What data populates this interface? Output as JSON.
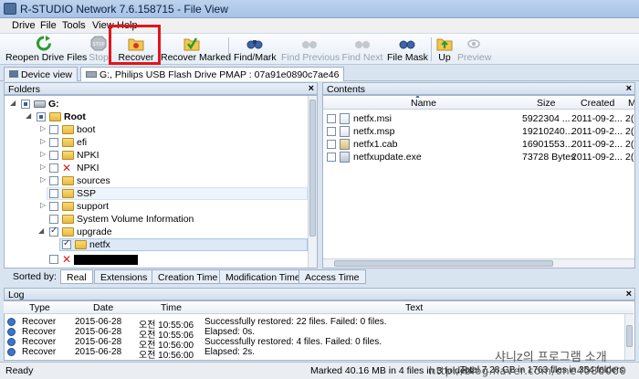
{
  "window": {
    "title": "R-STUDIO Network 7.6.158715 - File View"
  },
  "menu": [
    "Drive",
    "File",
    "Tools",
    "View",
    "Help"
  ],
  "toolbar": {
    "buttons": [
      {
        "label": "Reopen Drive Files",
        "icon": "green-refresh-icon",
        "enabled": true
      },
      {
        "label": "Stop",
        "icon": "stop-icon",
        "enabled": false
      },
      {
        "label": "Recover",
        "icon": "recover-folder-icon",
        "enabled": true
      },
      {
        "label": "Recover Marked",
        "icon": "recover-marked-icon",
        "enabled": true
      },
      {
        "label": "Find/Mark",
        "icon": "binoculars-icon",
        "enabled": true
      },
      {
        "label": "Find Previous",
        "icon": "binoculars-prev-icon",
        "enabled": false
      },
      {
        "label": "Find Next",
        "icon": "binoculars-next-icon",
        "enabled": false
      },
      {
        "label": "File Mask",
        "icon": "file-mask-icon",
        "enabled": true
      },
      {
        "label": "Up",
        "icon": "folder-up-icon",
        "enabled": true
      },
      {
        "label": "Preview",
        "icon": "eye-icon",
        "enabled": false
      }
    ],
    "highlighted": "Recover"
  },
  "tabs": [
    {
      "label": "Device view",
      "icon": "device-icon"
    },
    {
      "label": "G:, Philips USB Flash Drive PMAP : 07a91e0890c7ae46",
      "icon": "drive-icon"
    }
  ],
  "folders_pane": {
    "title": "Folders",
    "tree": [
      {
        "label": "G:",
        "bold": true,
        "expanded": true
      },
      {
        "label": "Root",
        "bold": true,
        "expanded": true
      },
      {
        "label": "boot"
      },
      {
        "label": "efi"
      },
      {
        "label": "NPKI"
      },
      {
        "label": "NPKI"
      },
      {
        "label": "sources"
      },
      {
        "label": "SSP"
      },
      {
        "label": "support"
      },
      {
        "label": "System Volume Information"
      },
      {
        "label": "upgrade",
        "checked": true
      },
      {
        "label": "netfx",
        "checked": true,
        "selected": true
      },
      {
        "label": ""
      }
    ]
  },
  "sorted_by": {
    "label": "Sorted by:",
    "tabs": [
      "Real",
      "Extensions",
      "Creation Time",
      "Modification Time",
      "Access Time"
    ],
    "active": "Real"
  },
  "contents_pane": {
    "title": "Contents",
    "columns": [
      "Name",
      "Size",
      "Created",
      "M"
    ],
    "rows": [
      {
        "name": "netfx.msi",
        "size": "5922304 ...",
        "created": "2011-09-2...",
        "m": "2("
      },
      {
        "name": "netfx.msp",
        "size": "19210240...",
        "created": "2011-09-2...",
        "m": "2("
      },
      {
        "name": "netfx1.cab",
        "size": "16901553...",
        "created": "2011-09-2...",
        "m": "2("
      },
      {
        "name": "netfxupdate.exe",
        "size": "73728 Bytes",
        "created": "2011-09-2...",
        "m": "2("
      }
    ]
  },
  "log": {
    "title": "Log",
    "columns": [
      "Type",
      "Date",
      "Time",
      "Text"
    ],
    "rows": [
      {
        "type": "Recover",
        "date": "2015-06-28",
        "time": "오전 10:55:06",
        "text": "Successfully restored: 22 files. Failed: 0 files."
      },
      {
        "type": "Recover",
        "date": "2015-06-28",
        "time": "오전 10:55:06",
        "text": "Elapsed: 0s."
      },
      {
        "type": "Recover",
        "date": "2015-06-28",
        "time": "오전 10:56:00",
        "text": "Successfully restored: 4 files. Failed: 0 files."
      },
      {
        "type": "Recover",
        "date": "2015-06-28",
        "time": "오전 10:56:00",
        "text": "Elapsed: 2s."
      }
    ]
  },
  "status": {
    "left": "Ready",
    "middle": "Marked 40.16 MB in 4 files in 3 folders",
    "right": "Total 7.28 GB in 1763 files in 354 folders"
  },
  "watermark": {
    "line1": "샤니z의 프로그램 소개",
    "line2": "http://blog.naver.com/one4086060"
  }
}
